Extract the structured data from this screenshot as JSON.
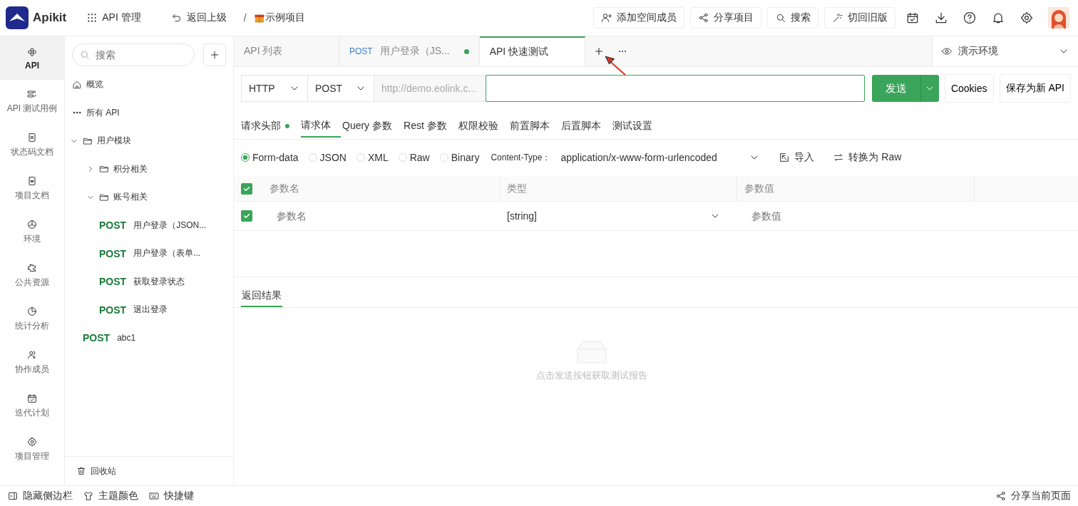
{
  "app": {
    "name": "Apikit"
  },
  "header": {
    "module": "API 管理",
    "back": "返回上级",
    "separator": "/",
    "project": "示例项目",
    "actions": [
      "添加空间成员",
      "分享项目",
      "搜索",
      "切回旧版"
    ]
  },
  "nav_rail": [
    {
      "label": "API",
      "selected": true
    },
    {
      "label": "API 测试用例",
      "selected": false
    },
    {
      "label": "状态码文档",
      "selected": false
    },
    {
      "label": "项目文档",
      "selected": false
    },
    {
      "label": "环境",
      "selected": false
    },
    {
      "label": "公共资源",
      "selected": false
    },
    {
      "label": "统计分析",
      "selected": false
    },
    {
      "label": "协作成员",
      "selected": false
    },
    {
      "label": "迭代计划",
      "selected": false
    },
    {
      "label": "项目管理",
      "selected": false
    }
  ],
  "tree": {
    "search_placeholder": "搜索",
    "items": [
      {
        "kind": "home",
        "label": "概览"
      },
      {
        "kind": "all",
        "label": "所有 API"
      },
      {
        "kind": "folder",
        "label": "用户模块",
        "expanded": true,
        "children": [
          {
            "kind": "folder",
            "label": "积分相关",
            "expanded": false
          },
          {
            "kind": "folder",
            "label": "账号相关",
            "expanded": true,
            "children": [
              {
                "kind": "api",
                "method": "POST",
                "label": "用户登录（JSON..."
              },
              {
                "kind": "api",
                "method": "POST",
                "label": "用户登录（表单..."
              },
              {
                "kind": "api",
                "method": "POST",
                "label": "获取登录状态"
              },
              {
                "kind": "api",
                "method": "POST",
                "label": "退出登录"
              }
            ]
          }
        ]
      },
      {
        "kind": "api",
        "method": "POST",
        "label": "abc1"
      }
    ],
    "recycle": "回收站"
  },
  "tabs": [
    {
      "label": "API 列表",
      "selected": false,
      "modified": false
    },
    {
      "method": "POST",
      "label": "用户登录（JS...",
      "selected": false,
      "modified": true
    },
    {
      "label": "API 快速测试",
      "selected": true,
      "modified": false
    }
  ],
  "environment": "演示环境",
  "request": {
    "protocol": "HTTP",
    "method": "POST",
    "url_prefix": "http://demo.eolink.c...",
    "send": "发送",
    "buttons": [
      "Cookies",
      "保存为新 API"
    ]
  },
  "request_tabs": [
    {
      "label": "请求头部",
      "selected": false,
      "dot": true
    },
    {
      "label": "请求体",
      "selected": true,
      "dot": false
    },
    {
      "label": "Query 参数",
      "selected": false,
      "dot": false
    },
    {
      "label": "Rest 参数",
      "selected": false,
      "dot": false
    },
    {
      "label": "权限校验",
      "selected": false,
      "dot": false
    },
    {
      "label": "前置脚本",
      "selected": false,
      "dot": false
    },
    {
      "label": "后置脚本",
      "selected": false,
      "dot": false
    },
    {
      "label": "测试设置",
      "selected": false,
      "dot": false
    }
  ],
  "body_types": [
    {
      "label": "Form-data",
      "selected": true
    },
    {
      "label": "JSON",
      "selected": false
    },
    {
      "label": "XML",
      "selected": false
    },
    {
      "label": "Raw",
      "selected": false
    },
    {
      "label": "Binary",
      "selected": false
    }
  ],
  "content_type": {
    "label": "Content-Type：",
    "value": "application/x-www-form-urlencoded"
  },
  "body_actions": [
    "导入",
    "转换为 Raw"
  ],
  "params": {
    "all_checked": true,
    "columns": [
      "参数名",
      "类型",
      "参数值"
    ],
    "rows": [
      {
        "checked": true,
        "name_placeholder": "参数名",
        "type": "[string]",
        "value_placeholder": "参数值"
      }
    ]
  },
  "result": {
    "tab": "返回结果",
    "empty_message": "点击发送按钮获取测试报告"
  },
  "footer": {
    "left": [
      "隐藏侧边栏",
      "主题颜色",
      "快捷键"
    ],
    "share": "分享当前页面"
  }
}
